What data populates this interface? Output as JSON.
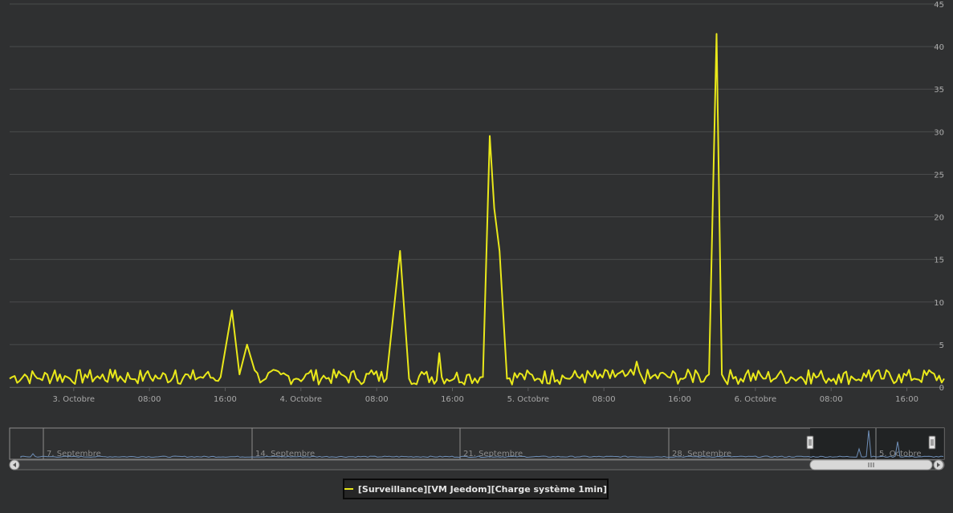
{
  "chart_data": {
    "type": "line",
    "series": [
      {
        "name": "[Surveillance][VM Jeedom][Charge système 1min]",
        "color": "#e9e81a",
        "points": [
          [
            0,
            1
          ],
          [
            2,
            1.5
          ],
          [
            4,
            1
          ],
          [
            6,
            2
          ],
          [
            8,
            1
          ],
          [
            10,
            1.5
          ],
          [
            12,
            1
          ],
          [
            14,
            2
          ],
          [
            16,
            1
          ],
          [
            18,
            1.5
          ],
          [
            20,
            1
          ],
          [
            22,
            2
          ],
          [
            24,
            1
          ],
          [
            26,
            1.5
          ],
          [
            28,
            1.2
          ],
          [
            29.5,
            9
          ],
          [
            30.5,
            1.5
          ],
          [
            31.5,
            5
          ],
          [
            32.5,
            2
          ],
          [
            34,
            1
          ],
          [
            36,
            1.5
          ],
          [
            38,
            1
          ],
          [
            40,
            2
          ],
          [
            42,
            1
          ],
          [
            44,
            1.5
          ],
          [
            46,
            1
          ],
          [
            48,
            2
          ],
          [
            50,
            1
          ],
          [
            51.8,
            16
          ],
          [
            53,
            1
          ],
          [
            55,
            1.5
          ],
          [
            57,
            4
          ],
          [
            59,
            1
          ],
          [
            61,
            1.5
          ],
          [
            62.8,
            1.2
          ],
          [
            63.7,
            29.5
          ],
          [
            64.3,
            21
          ],
          [
            65,
            16
          ],
          [
            66,
            1
          ],
          [
            68,
            1.5
          ],
          [
            70,
            1
          ],
          [
            72,
            2
          ],
          [
            74,
            1
          ],
          [
            76,
            1.5
          ],
          [
            78,
            1
          ],
          [
            80,
            2
          ],
          [
            82,
            1.5
          ],
          [
            83.2,
            3
          ],
          [
            85,
            1
          ],
          [
            87,
            1.5
          ],
          [
            89,
            1
          ],
          [
            91,
            2
          ],
          [
            92.8,
            1.5
          ],
          [
            93.8,
            41.5
          ],
          [
            94.5,
            1.5
          ],
          [
            96,
            1
          ],
          [
            98,
            2
          ],
          [
            100,
            1
          ],
          [
            102,
            1.5
          ],
          [
            104,
            1
          ],
          [
            106,
            2
          ],
          [
            108,
            1
          ],
          [
            110,
            1.5
          ],
          [
            112,
            1
          ],
          [
            114,
            2
          ],
          [
            116,
            1
          ],
          [
            118,
            1.5
          ],
          [
            120,
            1
          ],
          [
            122,
            2
          ],
          [
            124,
            1
          ]
        ],
        "noise_note_removed": true
      }
    ],
    "x_tick_labels": [
      "3. Octobre",
      "08:00",
      "16:00",
      "4. Octobre",
      "08:00",
      "16:00",
      "5. Octobre",
      "08:00",
      "16:00",
      "6. Octobre",
      "08:00",
      "16:00"
    ],
    "y_tick_labels": [
      "0",
      "5",
      "10",
      "15",
      "20",
      "25",
      "30",
      "35",
      "40",
      "45"
    ],
    "ylim": [
      0,
      45
    ],
    "y_axis_side": "right",
    "grid": true,
    "navigator": {
      "labels": [
        "7. Septembre",
        "14. Septembre",
        "21. Septembre",
        "28. Septembre",
        "5. Octobre"
      ]
    },
    "legend_position": "bottom-center"
  },
  "colors": {
    "background": "#2f3031",
    "grid": "#4a4b4c",
    "series": "#e9e81a",
    "navigator_line": "#6f8fb8"
  }
}
